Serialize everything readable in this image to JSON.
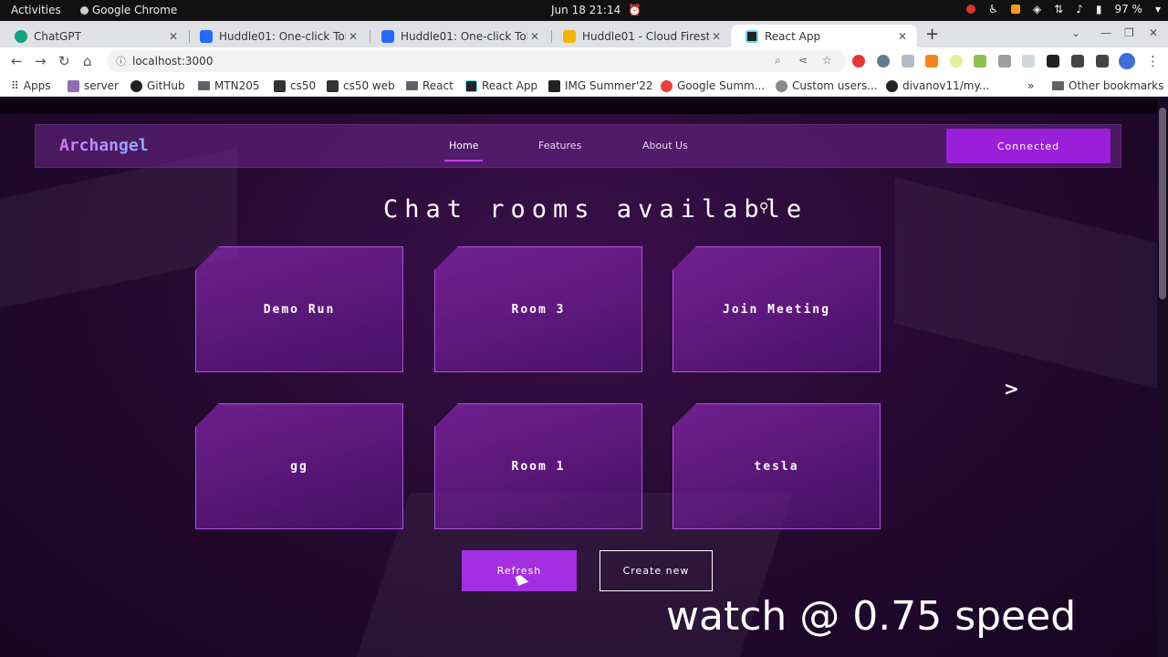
{
  "system_bar": {
    "activities": "Activities",
    "app_name": "Google Chrome",
    "datetime": "Jun 18  21:14",
    "battery": "97 %"
  },
  "tabs": [
    {
      "title": "ChatGPT",
      "color": "#10a37f"
    },
    {
      "title": "Huddle01: One-click Toke",
      "color": "#246bfd"
    },
    {
      "title": "Huddle01: One-click Toke",
      "color": "#246bfd"
    },
    {
      "title": "Huddle01 - Cloud Firestor",
      "color": "#f4b400"
    },
    {
      "title": "React App",
      "color": "#222222"
    }
  ],
  "address_bar": {
    "url": "localhost:3000"
  },
  "bookmarks": [
    {
      "label": "Apps",
      "icon": "apps-grid-icon"
    },
    {
      "label": "server",
      "icon": "server-icon"
    },
    {
      "label": "GitHub",
      "icon": "github-icon"
    },
    {
      "label": "MTN205",
      "icon": "folder-icon"
    },
    {
      "label": "cs50",
      "icon": "cs50-icon"
    },
    {
      "label": "cs50 web",
      "icon": "cs50-icon"
    },
    {
      "label": "React",
      "icon": "folder-icon"
    },
    {
      "label": "React App",
      "icon": "react-icon"
    },
    {
      "label": "IMG Summer'22",
      "icon": "img-icon"
    },
    {
      "label": "Google Summ...",
      "icon": "google-icon"
    },
    {
      "label": "Custom users...",
      "icon": "custom-icon"
    },
    {
      "label": "divanov11/my...",
      "icon": "github-icon"
    },
    {
      "label": "Other bookmarks",
      "icon": "folder-icon"
    }
  ],
  "app": {
    "brand": "Archangel",
    "nav": [
      {
        "label": "Home",
        "active": true
      },
      {
        "label": "Features",
        "active": false
      },
      {
        "label": "About Us",
        "active": false
      }
    ],
    "connect_button": "Connected",
    "heading": "Chat rooms available",
    "rooms": [
      "Demo Run",
      "Room 3",
      "Join Meeting",
      "gg",
      "Room 1",
      "tesla"
    ],
    "next_arrow": ">",
    "refresh_button": "Refresh",
    "create_button": "Create new",
    "overlay_text": "watch @ 0.75 speed",
    "colors": {
      "accent": "#9b1fd9",
      "background": "#260a33"
    }
  }
}
